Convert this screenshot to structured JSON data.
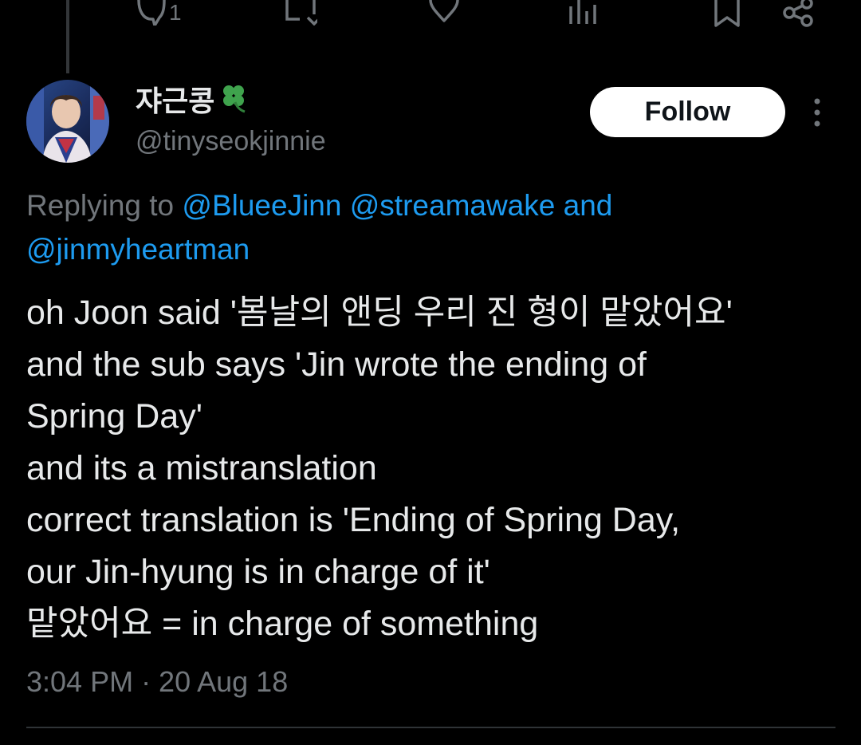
{
  "actions": {
    "reply_count": "1"
  },
  "author": {
    "display_name": "쟈근콩",
    "handle": "@tinyseokjinnie"
  },
  "follow_label": "Follow",
  "replying": {
    "prefix": "Replying to",
    "mention_1": "@BlueeJinn",
    "mention_2": "@streamawake",
    "conjunction": "and",
    "mention_3": "@jinmyheartman"
  },
  "tweet": {
    "lines": [
      "oh Joon said '봄날의 앤딩 우리 진 형이 맡았어요'",
      "and the sub says 'Jin wrote the ending of",
      "Spring Day'",
      "and its a mistranslation",
      "correct translation is 'Ending of Spring Day,",
      "our Jin-hyung is in charge of it'",
      "맡았어요 = in charge of something"
    ]
  },
  "timestamp": "3:04 PM · 20 Aug 18",
  "colors": {
    "background": "#000000",
    "text": "#e7e9ea",
    "muted": "#71767b",
    "link": "#1d9bf0",
    "follow_bg": "#ffffff"
  },
  "icons": [
    "reply-icon",
    "retweet-icon",
    "like-icon",
    "views-icon",
    "bookmark-icon",
    "share-icon",
    "more-icon",
    "clover-icon"
  ]
}
